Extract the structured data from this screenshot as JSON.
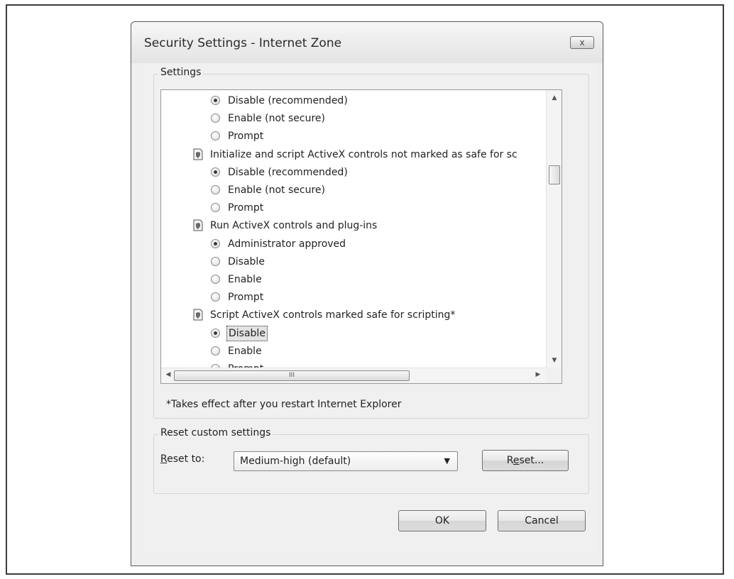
{
  "dialog": {
    "title": "Security Settings - Internet Zone",
    "close_glyph": "x"
  },
  "settings_group": {
    "legend": "Settings",
    "rows": [
      {
        "kind": "option",
        "label": "Disable (recommended)",
        "checked": true
      },
      {
        "kind": "option",
        "label": "Enable (not secure)",
        "checked": false
      },
      {
        "kind": "option",
        "label": "Prompt",
        "checked": false
      },
      {
        "kind": "category",
        "label": "Initialize and script ActiveX controls not marked as safe for sc"
      },
      {
        "kind": "option",
        "label": "Disable (recommended)",
        "checked": true
      },
      {
        "kind": "option",
        "label": "Enable (not secure)",
        "checked": false
      },
      {
        "kind": "option",
        "label": "Prompt",
        "checked": false
      },
      {
        "kind": "category",
        "label": "Run ActiveX controls and plug-ins"
      },
      {
        "kind": "option",
        "label": "Administrator approved",
        "checked": true
      },
      {
        "kind": "option",
        "label": "Disable",
        "checked": false
      },
      {
        "kind": "option",
        "label": "Enable",
        "checked": false
      },
      {
        "kind": "option",
        "label": "Prompt",
        "checked": false
      },
      {
        "kind": "category",
        "label": "Script ActiveX controls marked safe for scripting*"
      },
      {
        "kind": "option",
        "label": "Disable",
        "checked": true,
        "focused": true
      },
      {
        "kind": "option",
        "label": "Enable",
        "checked": false
      },
      {
        "kind": "option",
        "label": "Prompt",
        "checked": false
      }
    ],
    "note": "*Takes effect after you restart Internet Explorer",
    "hscroll_grip": "III"
  },
  "reset_group": {
    "legend": "Reset custom settings",
    "reset_to_label": "Reset to:",
    "reset_to_mnemonic": "R",
    "reset_to_rest": "eset to:",
    "select_value": "Medium-high (default)",
    "reset_button": "Reset...",
    "reset_button_pre": "R",
    "reset_button_mnemonic": "e",
    "reset_button_rest": "set..."
  },
  "buttons": {
    "ok": "OK",
    "cancel": "Cancel"
  },
  "colors": {
    "dialog_bg": "#f0f0f0",
    "list_bg": "#ffffff",
    "focus_bg": "#e3e3e3"
  }
}
